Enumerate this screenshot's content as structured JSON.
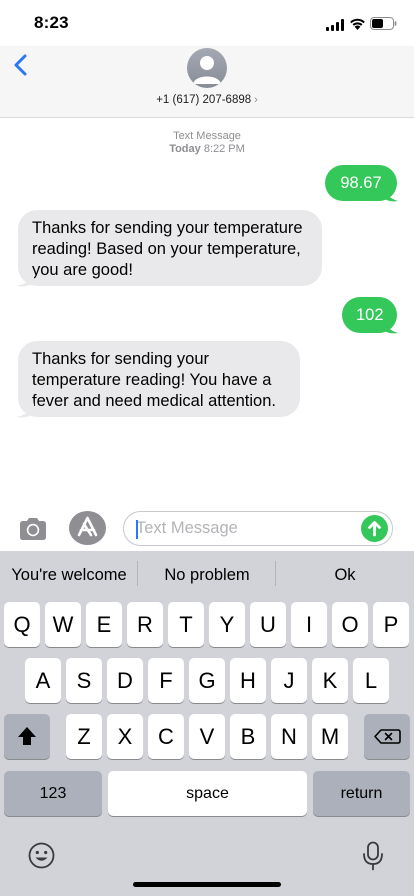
{
  "status_bar": {
    "time": "8:23"
  },
  "header": {
    "contact": "+1 (617) 207-6898",
    "chevron": "›"
  },
  "thread": {
    "service": "Text Message",
    "date_label": "Today",
    "time": "8:22 PM",
    "messages": [
      {
        "direction": "outgoing",
        "text": "98.67"
      },
      {
        "direction": "incoming",
        "text": "Thanks for sending your temperature reading! Based on your temperature, you are good!"
      },
      {
        "direction": "outgoing",
        "text": "102"
      },
      {
        "direction": "incoming",
        "text": "Thanks for sending your temperature reading! You have a fever and need medical attention."
      }
    ]
  },
  "compose": {
    "placeholder": "Text Message"
  },
  "keyboard": {
    "predictions": [
      "You're welcome",
      "No problem",
      "Ok"
    ],
    "row1": [
      "Q",
      "W",
      "E",
      "R",
      "T",
      "Y",
      "U",
      "I",
      "O",
      "P"
    ],
    "row2": [
      "A",
      "S",
      "D",
      "F",
      "G",
      "H",
      "J",
      "K",
      "L"
    ],
    "row3": [
      "Z",
      "X",
      "C",
      "V",
      "B",
      "N",
      "M"
    ],
    "numbers_label": "123",
    "space_label": "space",
    "return_label": "return"
  },
  "colors": {
    "accent": "#2a78f6",
    "outgoing_bubble": "#34c759",
    "incoming_bubble": "#e9e9eb"
  }
}
